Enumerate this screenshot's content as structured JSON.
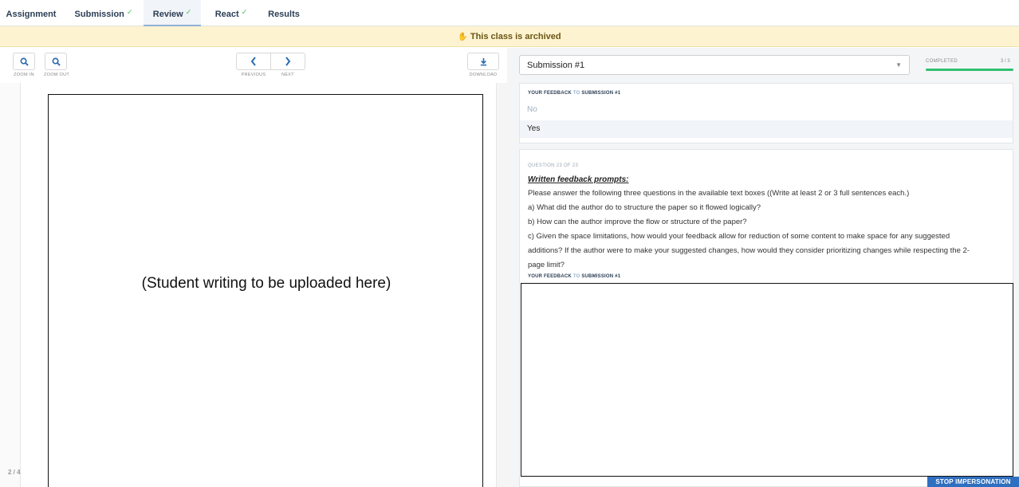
{
  "nav": {
    "tabs": [
      {
        "label": "Assignment",
        "check": ""
      },
      {
        "label": "Submission",
        "check": "✓"
      },
      {
        "label": "Review",
        "check": "✓"
      },
      {
        "label": "React",
        "check": "✓"
      },
      {
        "label": "Results",
        "check": ""
      }
    ],
    "active_tab": "Review"
  },
  "banner": {
    "text": "This class is archived"
  },
  "toolbar": {
    "zoom_in": "ZOOM IN",
    "zoom_out": "ZOOM OUT",
    "previous": "PREVIOUS",
    "next": "NEXT",
    "download": "DOWNLOAD"
  },
  "viewer": {
    "placeholder": "(Student writing to be uploaded here)",
    "page_count": "2 / 4"
  },
  "submission_select": {
    "value": "Submission #1"
  },
  "progress": {
    "label": "COMPLETED",
    "count": "3 / 3",
    "fraction": 1.0
  },
  "feedback1": {
    "label_a": "YOUR FEEDBACK",
    "label_to": "TO",
    "label_b": "SUBMISSION #1",
    "options": [
      "No",
      "Yes"
    ]
  },
  "question": {
    "number": "QUESTION 23 OF 23",
    "title": "Written feedback prompts:",
    "lines": [
      "Please answer the following three questions in the available text boxes ((Write at least 2 or 3 full sentences each.)",
      "a)   What did the author do to structure the paper so it flowed logically?",
      "b)   How can the author improve the flow or structure of the paper?",
      "c)   Given the space limitations, how would your feedback allow for reduction of some content to make space for any suggested",
      "additions? If the author were to make your suggested changes, how would they consider prioritizing changes while respecting the 2-",
      "page limit?"
    ]
  },
  "feedback2": {
    "label_a": "YOUR FEEDBACK",
    "label_to": "TO",
    "label_b": "SUBMISSION #1"
  },
  "stop_button": {
    "label": "STOP IMPERSONATION"
  },
  "colors": {
    "accent": "#2b6cb0",
    "progress": "#2fbf71",
    "banner": "#fdf3d0",
    "stop_button": "#2f6fbf"
  }
}
